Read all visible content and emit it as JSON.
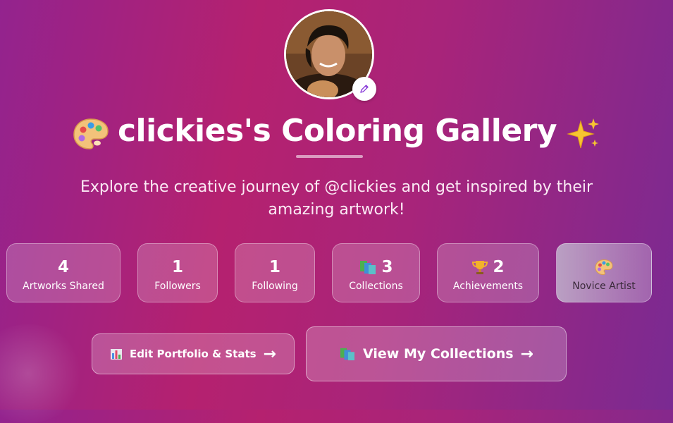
{
  "header": {
    "title": "clickies's Coloring Gallery",
    "title_left_icon": "palette-icon",
    "title_right_icon": "sparkles-icon",
    "subtitle": "Explore the creative journey of @clickies and get inspired by their amazing artwork!"
  },
  "profile": {
    "avatar_alt": "profile photo",
    "edit_icon": "pencil-icon"
  },
  "stats": [
    {
      "value": "4",
      "label": "Artworks Shared",
      "icon": ""
    },
    {
      "value": "1",
      "label": "Followers",
      "icon": ""
    },
    {
      "value": "1",
      "label": "Following",
      "icon": ""
    },
    {
      "value": "3",
      "label": "Collections",
      "icon": "books-icon"
    },
    {
      "value": "2",
      "label": "Achievements",
      "icon": "trophy-icon"
    }
  ],
  "badge": {
    "label": "Novice Artist",
    "icon": "palette-icon"
  },
  "actions": {
    "edit_portfolio": {
      "label": "Edit Portfolio & Stats",
      "icon": "bar-chart-icon",
      "arrow": "→"
    },
    "view_collections": {
      "label": "View My Collections",
      "icon": "books-icon",
      "arrow": "→"
    }
  },
  "colors": {
    "bg_left": "#93238e",
    "bg_mid": "#b5216f",
    "bg_right": "#7a2a92",
    "accent": "#8b3fd9"
  }
}
